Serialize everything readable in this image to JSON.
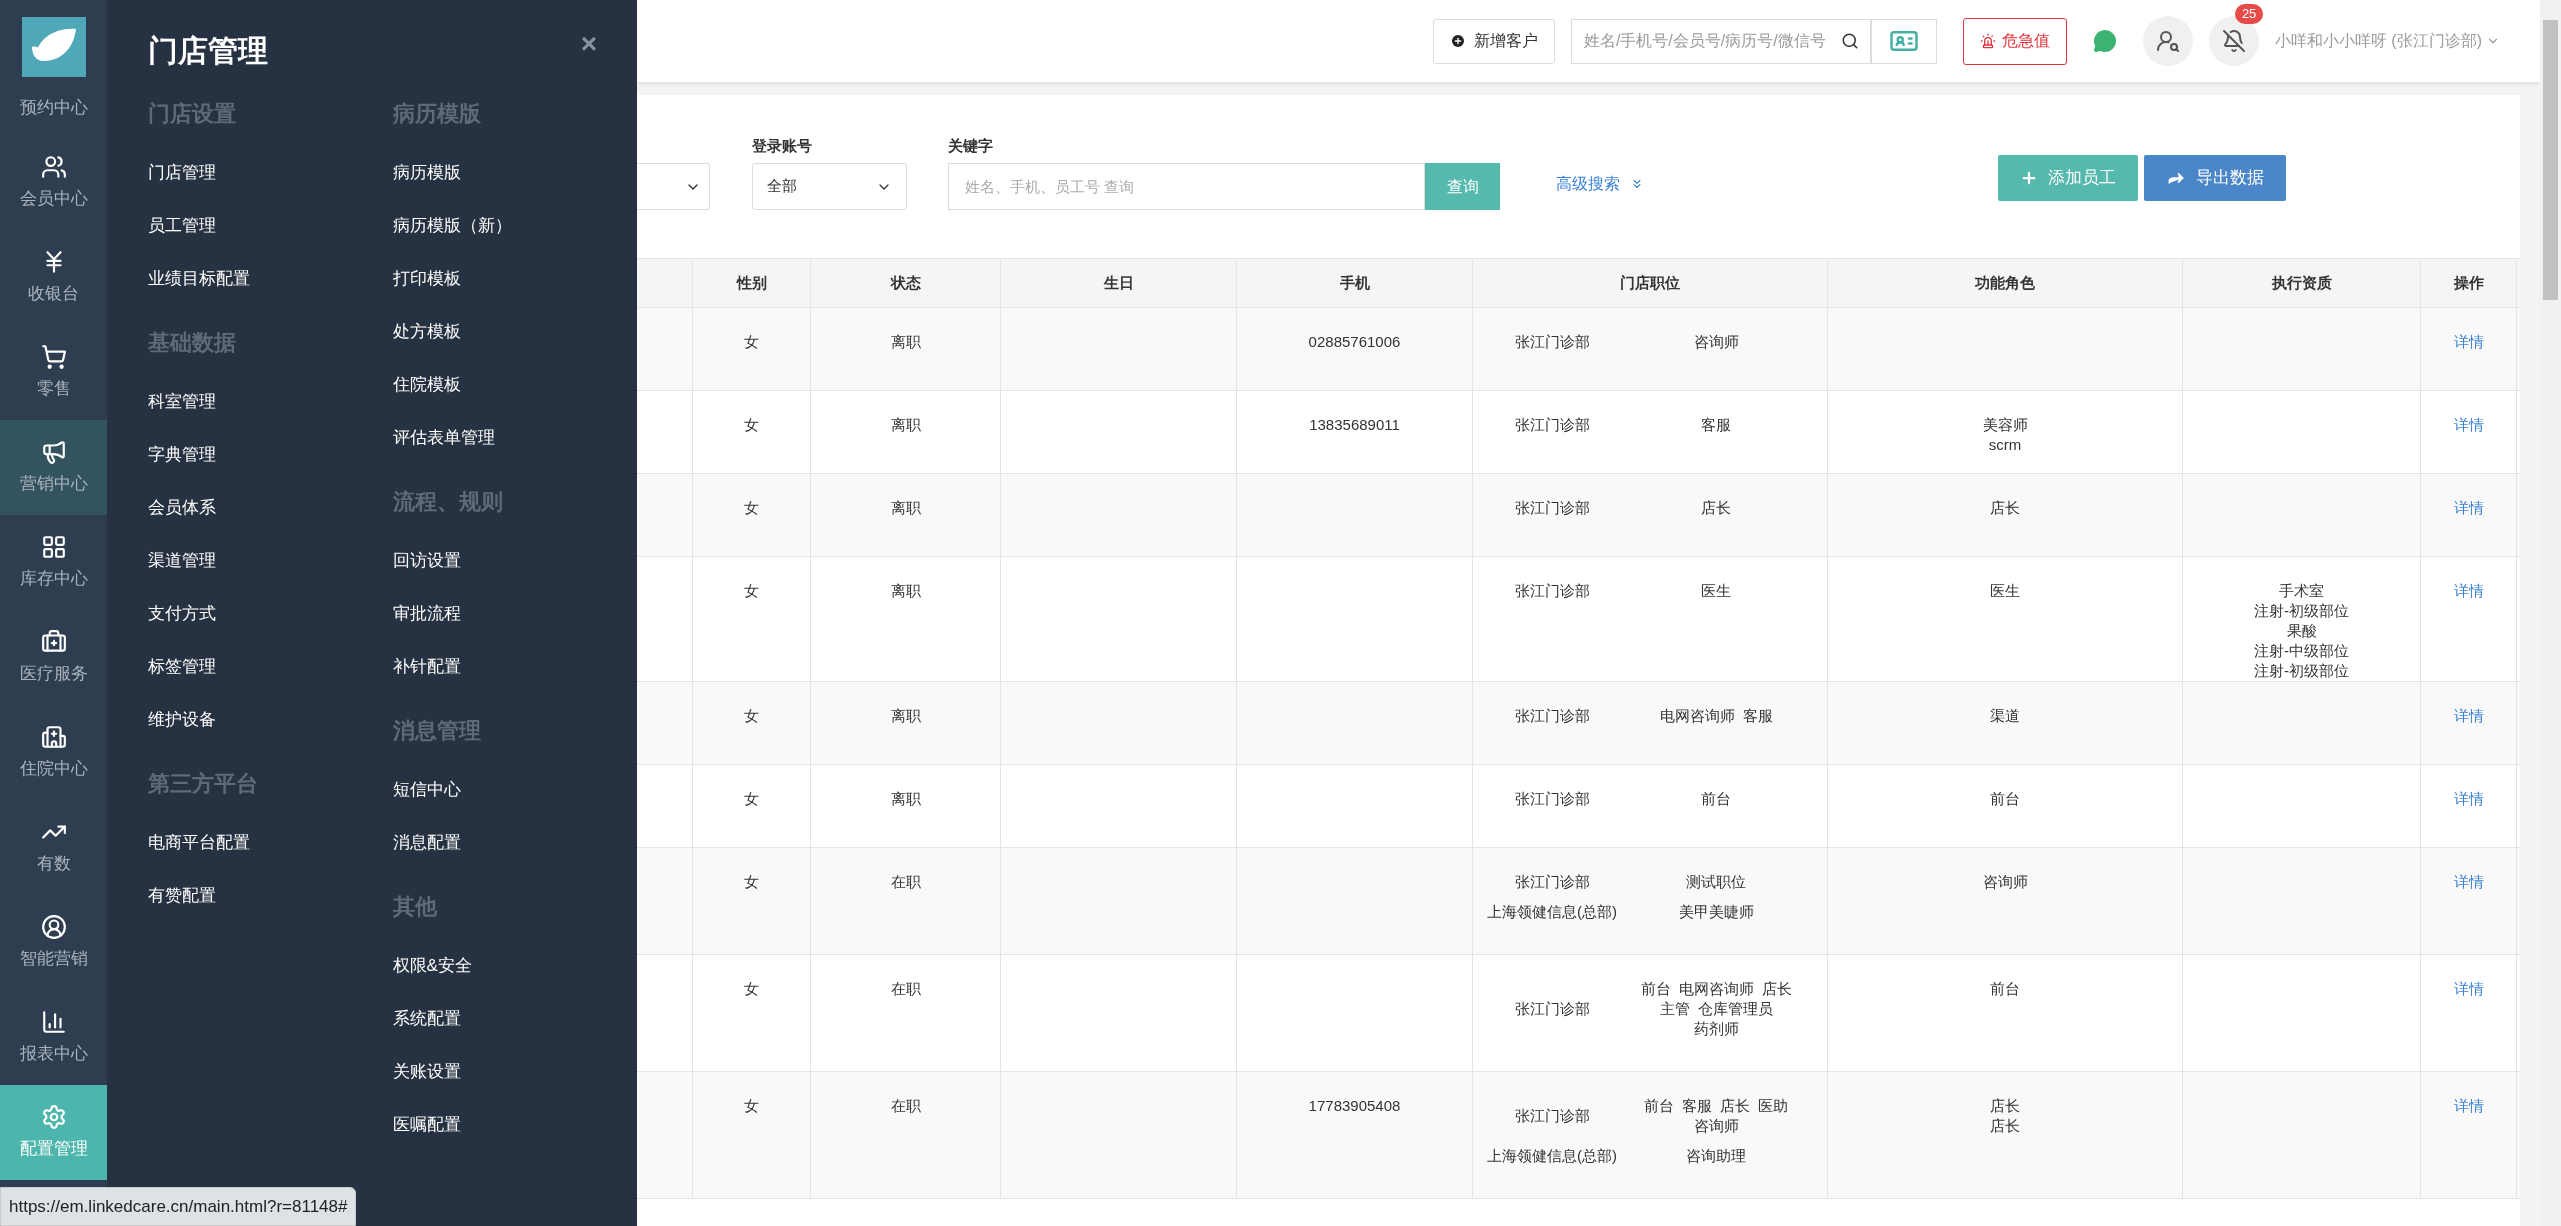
{
  "sidebar": {
    "items": [
      {
        "label": "预约中心",
        "selected": false,
        "highlighted": false
      },
      {
        "label": "会员中心",
        "selected": false,
        "highlighted": false
      },
      {
        "label": "收银台",
        "selected": false,
        "highlighted": false
      },
      {
        "label": "零售",
        "selected": false,
        "highlighted": false
      },
      {
        "label": "营销中心",
        "selected": false,
        "highlighted": true
      },
      {
        "label": "库存中心",
        "selected": false,
        "highlighted": false
      },
      {
        "label": "医疗服务",
        "selected": false,
        "highlighted": false
      },
      {
        "label": "住院中心",
        "selected": false,
        "highlighted": false
      },
      {
        "label": "有数",
        "selected": false,
        "highlighted": false
      },
      {
        "label": "智能营销",
        "selected": false,
        "highlighted": false
      },
      {
        "label": "报表中心",
        "selected": false,
        "highlighted": false
      },
      {
        "label": "配置管理",
        "selected": true,
        "highlighted": false
      }
    ]
  },
  "menu": {
    "title": "门店管理",
    "close": "×",
    "columns": [
      [
        {
          "heading": "门店设置",
          "items": [
            "门店管理",
            "员工管理",
            "业绩目标配置"
          ]
        },
        {
          "heading": "基础数据",
          "items": [
            "科室管理",
            "字典管理",
            "会员体系",
            "渠道管理",
            "支付方式",
            "标签管理",
            "维护设备"
          ]
        },
        {
          "heading": "第三方平台",
          "items": [
            "电商平台配置",
            "有赞配置"
          ]
        }
      ],
      [
        {
          "heading": "病历模版",
          "items": [
            "病历模版",
            "病历模版（新）",
            "打印模板",
            "处方模板",
            "住院模板",
            "评估表单管理"
          ]
        },
        {
          "heading": "流程、规则",
          "items": [
            "回访设置",
            "审批流程",
            "补针配置"
          ]
        },
        {
          "heading": "消息管理",
          "items": [
            "短信中心",
            "消息配置"
          ]
        },
        {
          "heading": "其他",
          "items": [
            "权限&安全",
            "系统配置",
            "关账设置",
            "医嘱配置"
          ]
        }
      ]
    ]
  },
  "topbar": {
    "new_customer": "新增客户",
    "search_placeholder": "姓名/手机号/会员号/病历号/微信号",
    "alert": "危急值",
    "notification_count": "25",
    "user": "小咩和小小咩呀 (张江门诊部)"
  },
  "filters": {
    "login_account": {
      "label": "登录账号",
      "value": "全部"
    },
    "keyword": {
      "label": "关键字",
      "placeholder": "姓名、手机、员工号 查询",
      "button": "查询"
    },
    "advanced_search": "高级搜索",
    "actions": [
      {
        "kind": "add",
        "label": "添加员工"
      },
      {
        "kind": "export",
        "label": "导出数据"
      }
    ]
  },
  "table": {
    "columns": [
      "性别",
      "状态",
      "生日",
      "手机",
      "门店职位",
      "功能角色",
      "执行资质",
      "操作"
    ],
    "rows": [
      {
        "gender": "女",
        "status": "离职",
        "phone": "02885761006",
        "positions": [
          {
            "store": "张江门诊部",
            "roles": [
              "咨询师"
            ]
          }
        ],
        "functional_roles": [],
        "qualifications": [],
        "action": "详情"
      },
      {
        "gender": "女",
        "status": "离职",
        "phone": "13835689011",
        "positions": [
          {
            "store": "张江门诊部",
            "roles": [
              "客服"
            ]
          }
        ],
        "functional_roles": [
          "美容师",
          "scrm"
        ],
        "qualifications": [],
        "action": "详情"
      },
      {
        "gender": "女",
        "status": "离职",
        "positions": [
          {
            "store": "张江门诊部",
            "roles": [
              "店长"
            ]
          }
        ],
        "functional_roles": [
          "店长"
        ],
        "qualifications": [],
        "action": "详情"
      },
      {
        "gender": "女",
        "status": "离职",
        "positions": [
          {
            "store": "张江门诊部",
            "roles": [
              "医生"
            ]
          }
        ],
        "functional_roles": [
          "医生"
        ],
        "qualifications": [
          "手术室",
          "注射-初级部位",
          "果酸",
          "注射-中级部位",
          "注射-初级部位"
        ],
        "action": "详情"
      },
      {
        "gender": "女",
        "status": "离职",
        "positions": [
          {
            "store": "张江门诊部",
            "roles": [
              "电网咨询师",
              "客服"
            ]
          }
        ],
        "functional_roles": [
          "渠道"
        ],
        "qualifications": [],
        "action": "详情"
      },
      {
        "gender": "女",
        "status": "离职",
        "positions": [
          {
            "store": "张江门诊部",
            "roles": [
              "前台"
            ]
          }
        ],
        "functional_roles": [
          "前台"
        ],
        "qualifications": [],
        "action": "详情"
      },
      {
        "gender": "女",
        "status": "在职",
        "positions": [
          {
            "store": "张江门诊部",
            "roles": [
              "测试职位"
            ]
          },
          {
            "store": "上海领健信息(总部)",
            "roles": [
              "美甲美睫师"
            ]
          }
        ],
        "functional_roles": [
          "咨询师"
        ],
        "qualifications": [],
        "action": "详情"
      },
      {
        "gender": "女",
        "status": "在职",
        "positions": [
          {
            "store": "张江门诊部",
            "roles": [
              "前台",
              "电网咨询师",
              "店长",
              "主管",
              "仓库管理员",
              "药剂师"
            ]
          }
        ],
        "functional_roles": [
          "前台"
        ],
        "qualifications": [],
        "action": "详情"
      },
      {
        "gender": "女",
        "status": "在职",
        "phone": "17783905408",
        "positions": [
          {
            "store": "张江门诊部",
            "roles": [
              "前台",
              "客服",
              "店长",
              "医助",
              "咨询师"
            ]
          },
          {
            "store": "上海领健信息(总部)",
            "roles": [
              "咨询助理"
            ]
          }
        ],
        "functional_roles": [
          "店长",
          "店长"
        ],
        "qualifications": [],
        "action": "详情"
      }
    ]
  },
  "status_bar": {
    "url": "https://em.linkedcare.cn/main.html?r=81148#"
  }
}
